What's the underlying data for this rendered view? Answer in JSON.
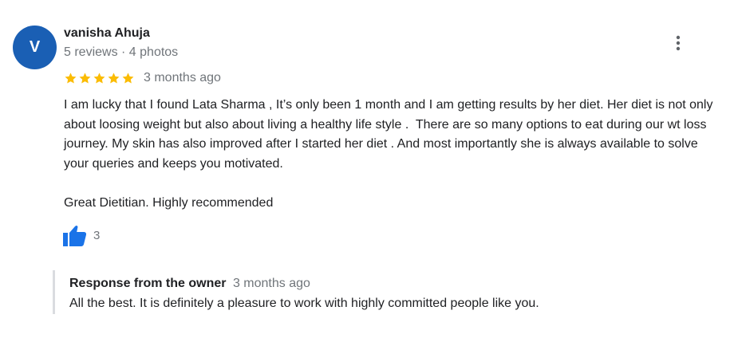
{
  "review": {
    "avatar_initial": "V",
    "author": "vanisha Ahuja",
    "meta": "5 reviews · 4 photos",
    "rating": 5,
    "time_ago": "3 months ago",
    "body_paragraphs": [
      "I am lucky that I found Lata Sharma , It’s only been 1 month and I am getting results by her diet. Her diet is not only about loosing weight but also about living a healthy life style .  There are so many options to eat during our wt loss journey. My skin has also improved after I started her diet . And most importantly she is always available to solve your queries and keeps you motivated.",
      "Great Dietitian. Highly recommended"
    ],
    "like_count": "3",
    "more_icon": "more-vert-icon",
    "like_icon": "thumbs-up-icon"
  },
  "owner_response": {
    "label": "Response from the owner",
    "time_ago": "3 months ago",
    "text": "All the best. It is definitely a pleasure to work with highly committed people like you."
  },
  "colors": {
    "avatar": "#1a5fb4",
    "star": "#fbbc04",
    "like": "#1a73e8",
    "secondary_text": "#70757a",
    "response_border": "#dadce0"
  }
}
